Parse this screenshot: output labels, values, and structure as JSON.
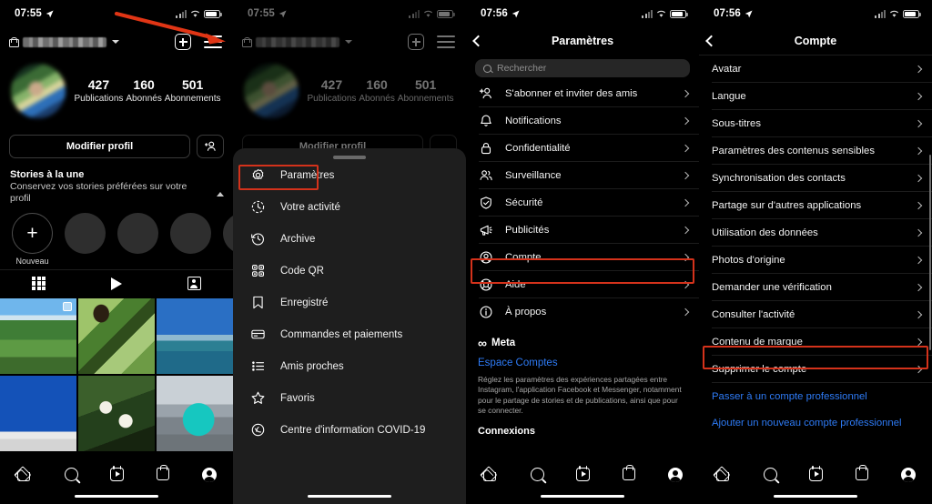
{
  "statusbar": {
    "time_left": "07:55",
    "time_right": "07:56",
    "location_arrow": "location-arrow-icon"
  },
  "panel1": {
    "name": "instagram-profile-screen",
    "username_redacted": true,
    "stats": [
      {
        "num": "427",
        "label": "Publications"
      },
      {
        "num": "160",
        "label": "Abonnés"
      },
      {
        "num": "501",
        "label": "Abonnements"
      }
    ],
    "edit_profile_label": "Modifier profil",
    "highlights_title": "Stories à la une",
    "highlights_subtitle": "Conservez vos stories préférées sur votre profil",
    "highlight_new_label": "Nouveau",
    "tabs": [
      "grid-tab",
      "reels-tab",
      "tagged-tab"
    ]
  },
  "panel2": {
    "name": "instagram-side-drawer",
    "items": [
      {
        "icon": "gear-icon",
        "label": "Paramètres",
        "highlighted": true
      },
      {
        "icon": "clock-activity-icon",
        "label": "Votre activité",
        "highlighted": false
      },
      {
        "icon": "archive-clock-icon",
        "label": "Archive",
        "highlighted": false
      },
      {
        "icon": "qr-code-icon",
        "label": "Code QR",
        "highlighted": false
      },
      {
        "icon": "bookmark-icon",
        "label": "Enregistré",
        "highlighted": false
      },
      {
        "icon": "credit-card-icon",
        "label": "Commandes et paiements",
        "highlighted": false
      },
      {
        "icon": "list-icon",
        "label": "Amis proches",
        "highlighted": false
      },
      {
        "icon": "star-icon",
        "label": "Favoris",
        "highlighted": false
      },
      {
        "icon": "covid-shield-icon",
        "label": "Centre d'information COVID-19",
        "highlighted": false
      }
    ]
  },
  "panel3": {
    "name": "settings-screen",
    "title": "Paramètres",
    "search_placeholder": "Rechercher",
    "items": [
      {
        "icon": "add-person-icon",
        "label": "S'abonner et inviter des amis",
        "highlighted": false
      },
      {
        "icon": "bell-icon",
        "label": "Notifications",
        "highlighted": false
      },
      {
        "icon": "lock-icon",
        "label": "Confidentialité",
        "highlighted": false
      },
      {
        "icon": "people-icon",
        "label": "Surveillance",
        "highlighted": false
      },
      {
        "icon": "shield-icon",
        "label": "Sécurité",
        "highlighted": false
      },
      {
        "icon": "megaphone-icon",
        "label": "Publicités",
        "highlighted": false
      },
      {
        "icon": "account-circle-icon",
        "label": "Compte",
        "highlighted": true
      },
      {
        "icon": "lifebuoy-icon",
        "label": "Aide",
        "highlighted": false
      },
      {
        "icon": "info-icon",
        "label": "À propos",
        "highlighted": false
      }
    ],
    "meta_brand": "Meta",
    "meta_link": "Espace Comptes",
    "meta_description": "Réglez les paramètres des expériences partagées entre Instagram, l'application Facebook et Messenger, notamment pour le partage de stories et de publications, ainsi que pour se connecter.",
    "section_header": "Connexions"
  },
  "panel4": {
    "name": "account-settings-screen",
    "title": "Compte",
    "items": [
      {
        "label": "Avatar",
        "type": "chevron",
        "highlighted": false
      },
      {
        "label": "Langue",
        "type": "chevron",
        "highlighted": false
      },
      {
        "label": "Sous-titres",
        "type": "chevron",
        "highlighted": false
      },
      {
        "label": "Paramètres des contenus sensibles",
        "type": "chevron",
        "highlighted": false
      },
      {
        "label": "Synchronisation des contacts",
        "type": "chevron",
        "highlighted": false
      },
      {
        "label": "Partage sur d'autres applications",
        "type": "chevron",
        "highlighted": false
      },
      {
        "label": "Utilisation des données",
        "type": "chevron",
        "highlighted": false
      },
      {
        "label": "Photos d'origine",
        "type": "chevron",
        "highlighted": false
      },
      {
        "label": "Demander une vérification",
        "type": "chevron",
        "highlighted": false
      },
      {
        "label": "Consulter l'activité",
        "type": "chevron",
        "highlighted": false
      },
      {
        "label": "Contenu de marque",
        "type": "chevron",
        "highlighted": false
      },
      {
        "label": "Supprimer le compte",
        "type": "chevron",
        "highlighted": true
      },
      {
        "label": "Passer à un compte professionnel",
        "type": "link",
        "highlighted": false
      },
      {
        "label": "Ajouter un nouveau compte professionnel",
        "type": "link",
        "highlighted": false
      }
    ]
  },
  "annotations": {
    "arrow_color": "#e03515",
    "highlight_color": "#d4321b"
  }
}
